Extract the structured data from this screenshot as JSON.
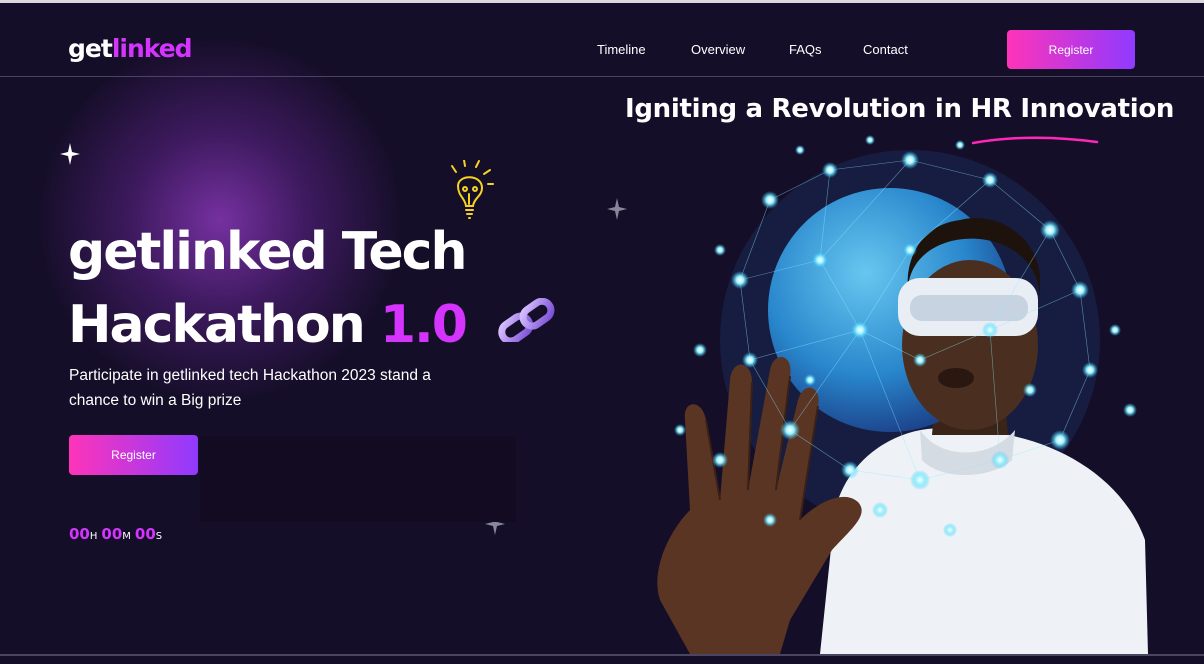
{
  "header": {
    "logo_part1": "get",
    "logo_part2": "linked",
    "nav": [
      "Timeline",
      "Overview",
      "FAQs",
      "Contact"
    ],
    "register_label": "Register"
  },
  "hero": {
    "tagline": "Igniting a Revolution in HR Innovation",
    "title_line1": "getlinked Tech",
    "title_line2": "Hackathon",
    "version": "1.0",
    "subtitle": "Participate in getlinked tech Hackathon 2023 stand a chance to win a Big prize",
    "register_label": "Register",
    "countdown": {
      "hours": "00",
      "hours_unit": "H",
      "minutes": "00",
      "minutes_unit": "M",
      "seconds": "00",
      "seconds_unit": "S"
    }
  },
  "colors": {
    "background": "#150e28",
    "accent": "#d434fe",
    "button_gradient_start": "#fe34b9",
    "button_gradient_end": "#903aff"
  },
  "icons": [
    "sparkle-star-icon",
    "lightbulb-icon",
    "chain-link-icon"
  ]
}
